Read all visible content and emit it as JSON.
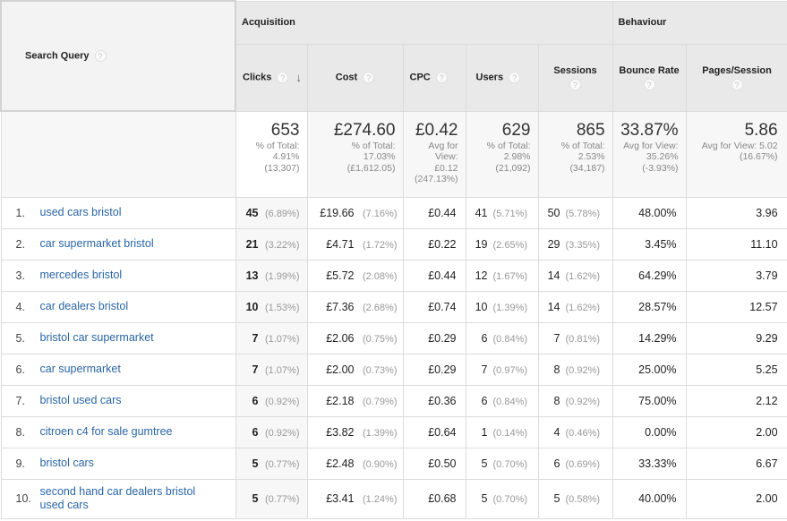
{
  "header": {
    "dimension": "Search Query",
    "groups": [
      "Acquisition",
      "Behaviour"
    ],
    "metrics": [
      "Clicks",
      "Cost",
      "CPC",
      "Users",
      "Sessions",
      "Bounce Rate",
      "Pages/Session"
    ],
    "help_icon_glyph": "?",
    "sort_icon_glyph": "↓"
  },
  "totals": {
    "clicks": {
      "value": "653",
      "line1": "% of Total:",
      "line2": "4.91%",
      "line3": "(13,307)"
    },
    "cost": {
      "value": "£274.60",
      "line1": "% of Total:",
      "line2": "17.03%",
      "line3": "(£1,612.05)"
    },
    "cpc": {
      "value": "£0.42",
      "line1": "Avg for",
      "line2": "View:",
      "line3": "£0.12",
      "line4": "(247.13%)"
    },
    "users": {
      "value": "629",
      "line1": "% of Total:",
      "line2": "2.98%",
      "line3": "(21,092)"
    },
    "sessions": {
      "value": "865",
      "line1": "% of Total:",
      "line2": "2.53%",
      "line3": "(34,187)"
    },
    "bounce_rate": {
      "value": "33.87%",
      "line1": "Avg for View:",
      "line2": "35.26%",
      "line3": "(-3.93%)"
    },
    "pages_session": {
      "value": "5.86",
      "line1": "Avg for View: 5.02",
      "line2": "(16.67%)"
    }
  },
  "rows": [
    {
      "index": "1.",
      "query": "used cars bristol",
      "clicks": "45",
      "clicks_pct": "(6.89%)",
      "cost": "£19.66",
      "cost_pct": "(7.16%)",
      "cpc": "£0.44",
      "users": "41",
      "users_pct": "(5.71%)",
      "sessions": "50",
      "sessions_pct": "(5.78%)",
      "bounce_rate": "48.00%",
      "pages_session": "3.96"
    },
    {
      "index": "2.",
      "query": "car supermarket bristol",
      "clicks": "21",
      "clicks_pct": "(3.22%)",
      "cost": "£4.71",
      "cost_pct": "(1.72%)",
      "cpc": "£0.22",
      "users": "19",
      "users_pct": "(2.65%)",
      "sessions": "29",
      "sessions_pct": "(3.35%)",
      "bounce_rate": "3.45%",
      "pages_session": "11.10"
    },
    {
      "index": "3.",
      "query": "mercedes bristol",
      "clicks": "13",
      "clicks_pct": "(1.99%)",
      "cost": "£5.72",
      "cost_pct": "(2.08%)",
      "cpc": "£0.44",
      "users": "12",
      "users_pct": "(1.67%)",
      "sessions": "14",
      "sessions_pct": "(1.62%)",
      "bounce_rate": "64.29%",
      "pages_session": "3.79"
    },
    {
      "index": "4.",
      "query": "car dealers bristol",
      "clicks": "10",
      "clicks_pct": "(1.53%)",
      "cost": "£7.36",
      "cost_pct": "(2.68%)",
      "cpc": "£0.74",
      "users": "10",
      "users_pct": "(1.39%)",
      "sessions": "14",
      "sessions_pct": "(1.62%)",
      "bounce_rate": "28.57%",
      "pages_session": "12.57"
    },
    {
      "index": "5.",
      "query": "bristol car supermarket",
      "clicks": "7",
      "clicks_pct": "(1.07%)",
      "cost": "£2.06",
      "cost_pct": "(0.75%)",
      "cpc": "£0.29",
      "users": "6",
      "users_pct": "(0.84%)",
      "sessions": "7",
      "sessions_pct": "(0.81%)",
      "bounce_rate": "14.29%",
      "pages_session": "9.29"
    },
    {
      "index": "6.",
      "query": "car supermarket",
      "clicks": "7",
      "clicks_pct": "(1.07%)",
      "cost": "£2.00",
      "cost_pct": "(0.73%)",
      "cpc": "£0.29",
      "users": "7",
      "users_pct": "(0.97%)",
      "sessions": "8",
      "sessions_pct": "(0.92%)",
      "bounce_rate": "25.00%",
      "pages_session": "5.25"
    },
    {
      "index": "7.",
      "query": "bristol used cars",
      "clicks": "6",
      "clicks_pct": "(0.92%)",
      "cost": "£2.18",
      "cost_pct": "(0.79%)",
      "cpc": "£0.36",
      "users": "6",
      "users_pct": "(0.84%)",
      "sessions": "8",
      "sessions_pct": "(0.92%)",
      "bounce_rate": "75.00%",
      "pages_session": "2.12"
    },
    {
      "index": "8.",
      "query": "citroen c4 for sale gumtree",
      "clicks": "6",
      "clicks_pct": "(0.92%)",
      "cost": "£3.82",
      "cost_pct": "(1.39%)",
      "cpc": "£0.64",
      "users": "1",
      "users_pct": "(0.14%)",
      "sessions": "4",
      "sessions_pct": "(0.46%)",
      "bounce_rate": "0.00%",
      "pages_session": "2.00"
    },
    {
      "index": "9.",
      "query": "bristol cars",
      "clicks": "5",
      "clicks_pct": "(0.77%)",
      "cost": "£2.48",
      "cost_pct": "(0.90%)",
      "cpc": "£0.50",
      "users": "5",
      "users_pct": "(0.70%)",
      "sessions": "6",
      "sessions_pct": "(0.69%)",
      "bounce_rate": "33.33%",
      "pages_session": "6.67"
    },
    {
      "index": "10.",
      "query": "second hand car dealers bristol used cars",
      "clicks": "5",
      "clicks_pct": "(0.77%)",
      "cost": "£3.41",
      "cost_pct": "(1.24%)",
      "cpc": "£0.68",
      "users": "5",
      "users_pct": "(0.70%)",
      "sessions": "5",
      "sessions_pct": "(0.58%)",
      "bounce_rate": "40.00%",
      "pages_session": "2.00"
    }
  ]
}
